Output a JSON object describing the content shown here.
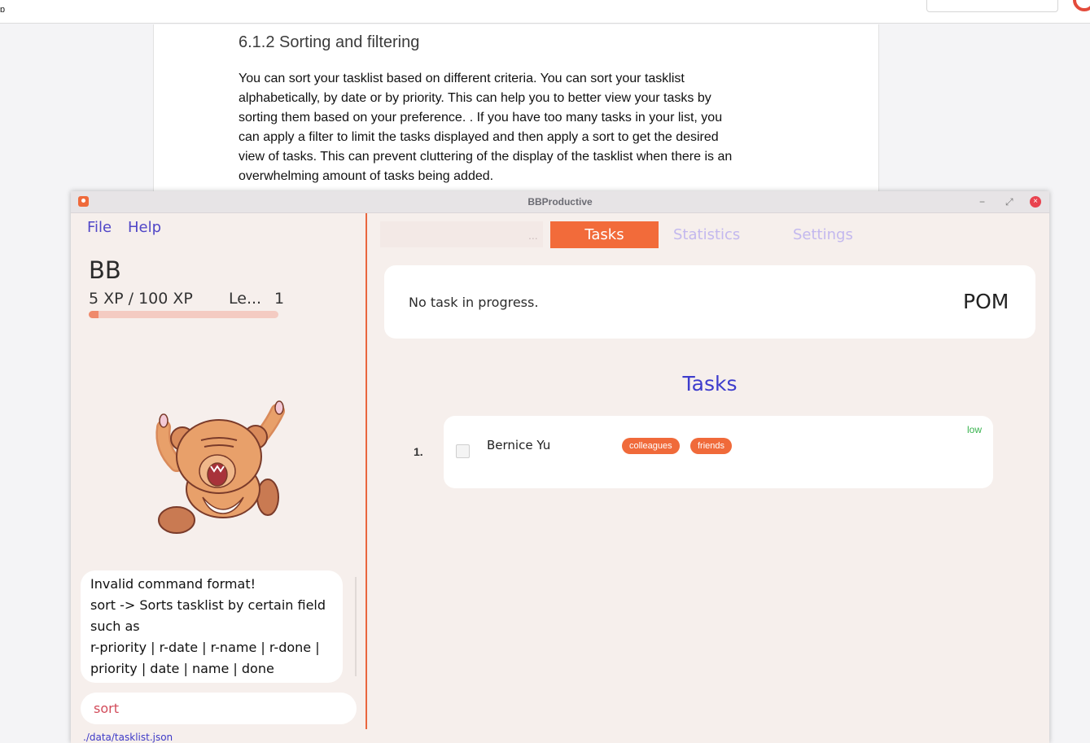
{
  "background_doc": {
    "heading": "6.1.2 Sorting and filtering",
    "paragraph_lines": [
      "You can sort your tasklist based on different criteria. You can sort your tasklist",
      "alphabetically, by date or by priority. This can help you to better view your tasks by",
      "sorting them based on your preference. . If you have too many tasks in your list, you",
      "can  apply a filter to limit the tasks displayed and then apply a sort to get the desired",
      "view of tasks. This can prevent cluttering of the display of the tasklist when there is an",
      "overwhelming amount of tasks being added."
    ]
  },
  "window": {
    "title": "BBProductive",
    "controls": {
      "minimize": "−",
      "maximize": "⤢",
      "close": "×"
    }
  },
  "menu": {
    "file": "File",
    "help": "Help"
  },
  "profile": {
    "name": "BB",
    "xp_text": "5 XP / 100 XP",
    "level_label": "Le...",
    "level_value": "1",
    "xp_progress": 0.05
  },
  "feedback": {
    "lines": [
      "Invalid command format!",
      "sort -> Sorts tasklist by certain field",
      "such as",
      "r-priority | r-date | r-name | r-done |",
      "priority | date | name | done"
    ]
  },
  "command_box": {
    "value": "sort"
  },
  "status_bar": {
    "path": "./data/tasklist.json"
  },
  "tabs": {
    "ellipsis": "...",
    "items": [
      {
        "label": "Tasks",
        "active": true
      },
      {
        "label": "Statistics",
        "active": false
      },
      {
        "label": "Settings",
        "active": false
      }
    ]
  },
  "pomodoro": {
    "status": "No task in progress.",
    "label": "POM"
  },
  "task_list": {
    "heading": "Tasks",
    "tasks": [
      {
        "index": "1.",
        "name": "Bernice Yu",
        "done": false,
        "tags": [
          "colleagues",
          "friends"
        ],
        "priority": "low"
      }
    ]
  },
  "colors": {
    "accent": "#f26b3a",
    "menu_text": "#5046c7",
    "heading_blue": "#3d3ccc",
    "priority_low": "#37b24d"
  }
}
